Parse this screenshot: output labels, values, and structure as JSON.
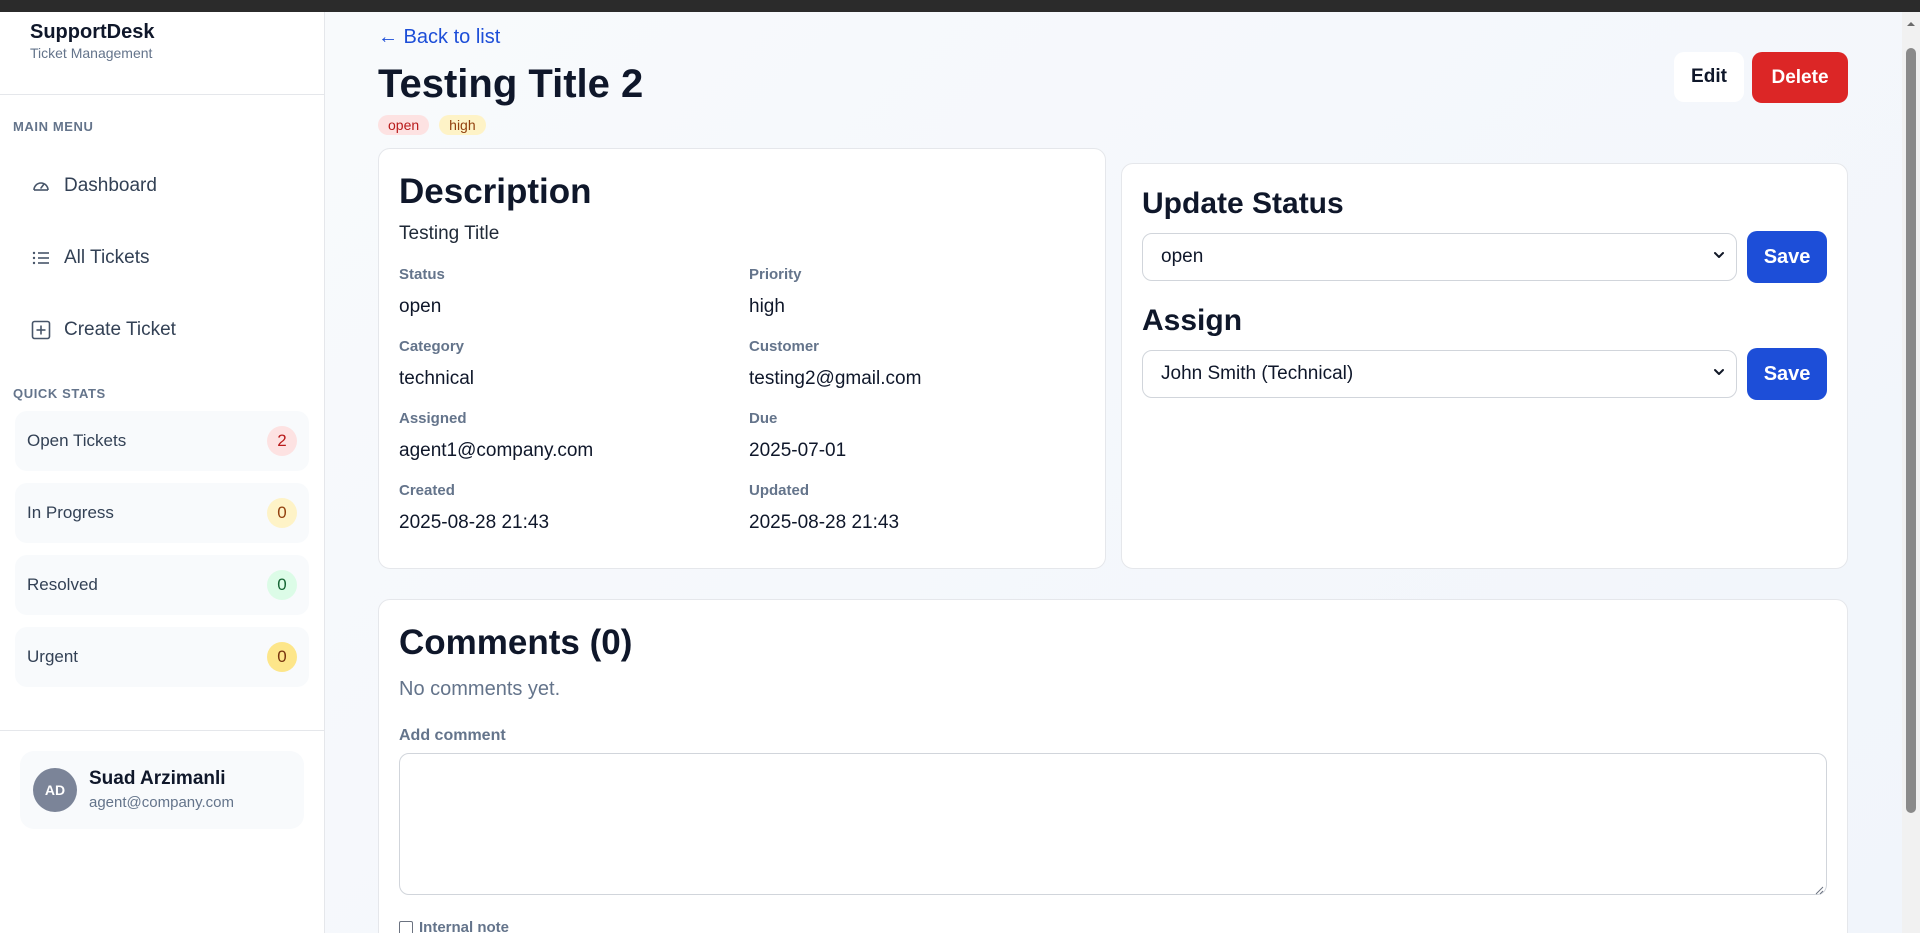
{
  "brand": {
    "name": "SupportDesk",
    "subtitle": "Ticket Management"
  },
  "sidebar": {
    "main_menu_title": "MAIN MENU",
    "menu": [
      {
        "label": "Dashboard",
        "icon": "gauge-icon"
      },
      {
        "label": "All Tickets",
        "icon": "list-icon"
      },
      {
        "label": "Create Ticket",
        "icon": "plus-square-icon"
      }
    ],
    "quick_stats_title": "QUICK STATS",
    "stats": [
      {
        "label": "Open Tickets",
        "count": "2",
        "badge_bg": "#fde2e2",
        "badge_color": "#b91c1c"
      },
      {
        "label": "In Progress",
        "count": "0",
        "badge_bg": "#fef3c7",
        "badge_color": "#92400e"
      },
      {
        "label": "Resolved",
        "count": "0",
        "badge_bg": "#dcfce7",
        "badge_color": "#166534"
      },
      {
        "label": "Urgent",
        "count": "0",
        "badge_bg": "#fde68a",
        "badge_color": "#78350f"
      }
    ],
    "user": {
      "initials": "AD",
      "name": "Suad Arzimanli",
      "email": "agent@company.com"
    }
  },
  "header": {
    "back_link": "← Back to list",
    "title": "Testing Title 2",
    "tags": {
      "status": "open",
      "priority": "high"
    },
    "edit_label": "Edit",
    "delete_label": "Delete"
  },
  "description": {
    "heading": "Description",
    "text": "Testing Title",
    "fields": {
      "status": {
        "label": "Status",
        "value": "open"
      },
      "priority": {
        "label": "Priority",
        "value": "high"
      },
      "category": {
        "label": "Category",
        "value": "technical"
      },
      "customer": {
        "label": "Customer",
        "value": "testing2@gmail.com"
      },
      "assigned": {
        "label": "Assigned",
        "value": "agent1@company.com"
      },
      "due": {
        "label": "Due",
        "value": "2025-07-01"
      },
      "created": {
        "label": "Created",
        "value": "2025-08-28 21:43"
      },
      "updated": {
        "label": "Updated",
        "value": "2025-08-28 21:43"
      }
    }
  },
  "status_panel": {
    "update_heading": "Update Status",
    "status_selected": "open",
    "assign_heading": "Assign",
    "assignee_selected": "John Smith (Technical)",
    "save_label": "Save"
  },
  "comments": {
    "heading": "Comments (0)",
    "empty_text": "No comments yet.",
    "add_label": "Add comment",
    "internal_note_label": "Internal note"
  },
  "colors": {
    "accent": "#1d4ed8",
    "danger": "#dc2626"
  }
}
